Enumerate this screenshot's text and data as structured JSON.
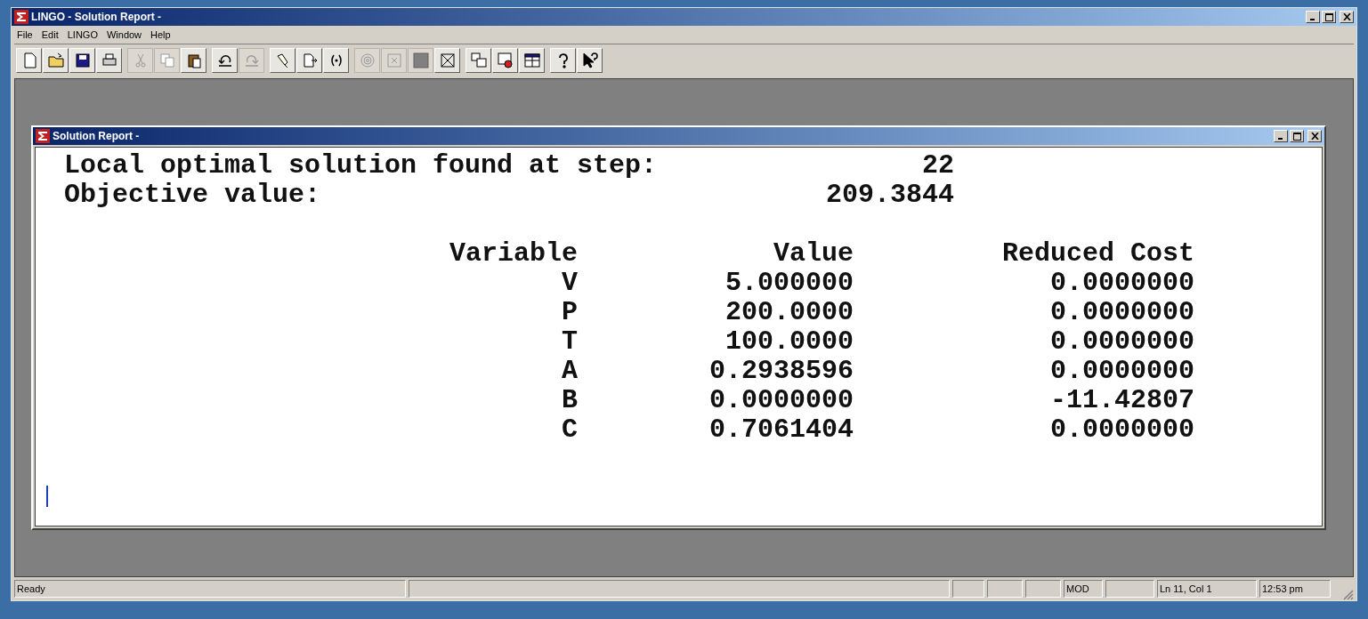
{
  "window": {
    "title": "LINGO - Solution Report -"
  },
  "menu": [
    "File",
    "Edit",
    "LINGO",
    "Window",
    "Help"
  ],
  "toolbar": [
    [
      {
        "disabled": false
      },
      {
        "disabled": false
      },
      {
        "disabled": false
      },
      {
        "disabled": false
      }
    ],
    [
      {
        "disabled": true
      },
      {
        "disabled": true
      },
      {
        "disabled": false
      }
    ],
    [
      {
        "disabled": false
      },
      {
        "disabled": true
      }
    ],
    [
      {
        "disabled": false
      },
      {
        "disabled": false
      },
      {
        "disabled": false
      }
    ],
    [
      {
        "disabled": true
      },
      {
        "disabled": true
      },
      {
        "disabled": true
      },
      {
        "disabled": false
      }
    ],
    [
      {
        "disabled": false
      },
      {
        "disabled": false
      },
      {
        "disabled": false
      }
    ],
    [
      {
        "disabled": false
      },
      {
        "disabled": false
      }
    ]
  ],
  "child_window": {
    "title": "Solution Report -"
  },
  "report": {
    "summary": [
      {
        "label": "Local optimal solution found at step:",
        "value": "22"
      },
      {
        "label": "Objective value:",
        "value": "209.3844"
      }
    ],
    "columns": [
      "Variable",
      "Value",
      "Reduced Cost"
    ],
    "rows": [
      [
        "V",
        "5.000000",
        "0.0000000"
      ],
      [
        "P",
        "200.0000",
        "0.0000000"
      ],
      [
        "T",
        "100.0000",
        "0.0000000"
      ],
      [
        "A",
        "0.2938596",
        "0.0000000"
      ],
      [
        "B",
        "0.0000000",
        "-11.42807"
      ],
      [
        "C",
        "0.7061404",
        "0.0000000"
      ]
    ]
  },
  "status_bar": {
    "message": "Ready",
    "mode": "MOD",
    "position": "Ln 11, Col 1",
    "time": "12:53 pm"
  }
}
